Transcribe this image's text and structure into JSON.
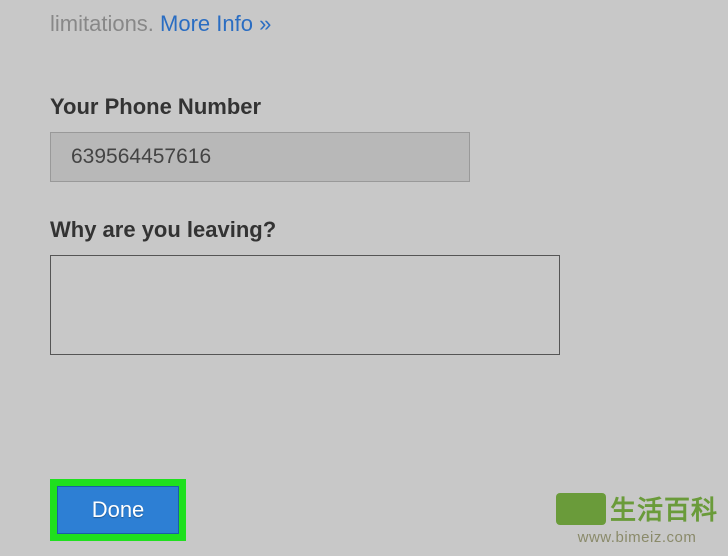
{
  "intro": {
    "text_fragment": "limitations.",
    "link_text": "More Info »"
  },
  "phone": {
    "label": "Your Phone Number",
    "value": "639564457616"
  },
  "reason": {
    "label": "Why are you leaving?",
    "value": ""
  },
  "actions": {
    "done_label": "Done"
  },
  "watermark": {
    "chars": "生活百科",
    "url": "www.bimeiz.com"
  }
}
